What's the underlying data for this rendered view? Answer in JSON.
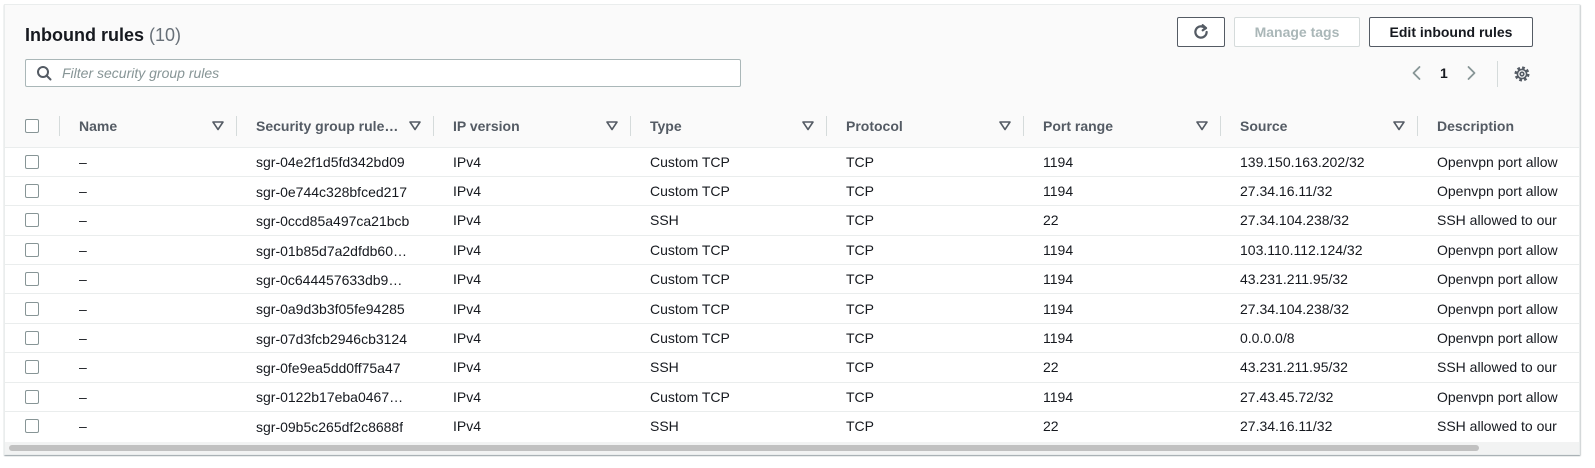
{
  "header": {
    "title": "Inbound rules",
    "count": "(10)",
    "manage_tags_label": "Manage tags",
    "edit_inbound_rules_label": "Edit inbound rules"
  },
  "search": {
    "placeholder": "Filter security group rules",
    "value": ""
  },
  "pagination": {
    "current_page": "1"
  },
  "table": {
    "columns": [
      "Name",
      "Security group rule…",
      "IP version",
      "Type",
      "Protocol",
      "Port range",
      "Source",
      "Description"
    ],
    "rows": [
      {
        "name": "–",
        "rule_id": "sgr-04e2f1d5fd342bd09",
        "ip_version": "IPv4",
        "type": "Custom TCP",
        "protocol": "TCP",
        "port_range": "1194",
        "source": "139.150.163.202/32",
        "description": "Openvpn port allow"
      },
      {
        "name": "–",
        "rule_id": "sgr-0e744c328bfced217",
        "ip_version": "IPv4",
        "type": "Custom TCP",
        "protocol": "TCP",
        "port_range": "1194",
        "source": "27.34.16.11/32",
        "description": "Openvpn port allow"
      },
      {
        "name": "–",
        "rule_id": "sgr-0ccd85a497ca21bcb",
        "ip_version": "IPv4",
        "type": "SSH",
        "protocol": "TCP",
        "port_range": "22",
        "source": "27.34.104.238/32",
        "description": "SSH allowed to our"
      },
      {
        "name": "–",
        "rule_id": "sgr-01b85d7a2dfdb60…",
        "ip_version": "IPv4",
        "type": "Custom TCP",
        "protocol": "TCP",
        "port_range": "1194",
        "source": "103.110.112.124/32",
        "description": "Openvpn port allow"
      },
      {
        "name": "–",
        "rule_id": "sgr-0c644457633db9…",
        "ip_version": "IPv4",
        "type": "Custom TCP",
        "protocol": "TCP",
        "port_range": "1194",
        "source": "43.231.211.95/32",
        "description": "Openvpn port allow"
      },
      {
        "name": "–",
        "rule_id": "sgr-0a9d3b3f05fe94285",
        "ip_version": "IPv4",
        "type": "Custom TCP",
        "protocol": "TCP",
        "port_range": "1194",
        "source": "27.34.104.238/32",
        "description": "Openvpn port allow"
      },
      {
        "name": "–",
        "rule_id": "sgr-07d3fcb2946cb3124",
        "ip_version": "IPv4",
        "type": "Custom TCP",
        "protocol": "TCP",
        "port_range": "1194",
        "source": "0.0.0.0/8",
        "description": "Openvpn port allow"
      },
      {
        "name": "–",
        "rule_id": "sgr-0fe9ea5dd0ff75a47",
        "ip_version": "IPv4",
        "type": "SSH",
        "protocol": "TCP",
        "port_range": "22",
        "source": "43.231.211.95/32",
        "description": "SSH allowed to our"
      },
      {
        "name": "–",
        "rule_id": "sgr-0122b17eba0467…",
        "ip_version": "IPv4",
        "type": "Custom TCP",
        "protocol": "TCP",
        "port_range": "1194",
        "source": "27.43.45.72/32",
        "description": "Openvpn port allow"
      },
      {
        "name": "–",
        "rule_id": "sgr-09b5c265df2c8688f",
        "ip_version": "IPv4",
        "type": "SSH",
        "protocol": "TCP",
        "port_range": "22",
        "source": "27.34.16.11/32",
        "description": "SSH allowed to our"
      }
    ]
  },
  "icons": {
    "refresh": "refresh-icon",
    "search": "search-icon",
    "prev": "chevron-left-icon",
    "next": "chevron-right-icon",
    "settings": "gear-icon",
    "sort": "caret-down-icon"
  },
  "colors": {
    "text": "#16191f",
    "muted": "#545b64",
    "border": "#eaeded",
    "header_bg": "#fafafa"
  }
}
